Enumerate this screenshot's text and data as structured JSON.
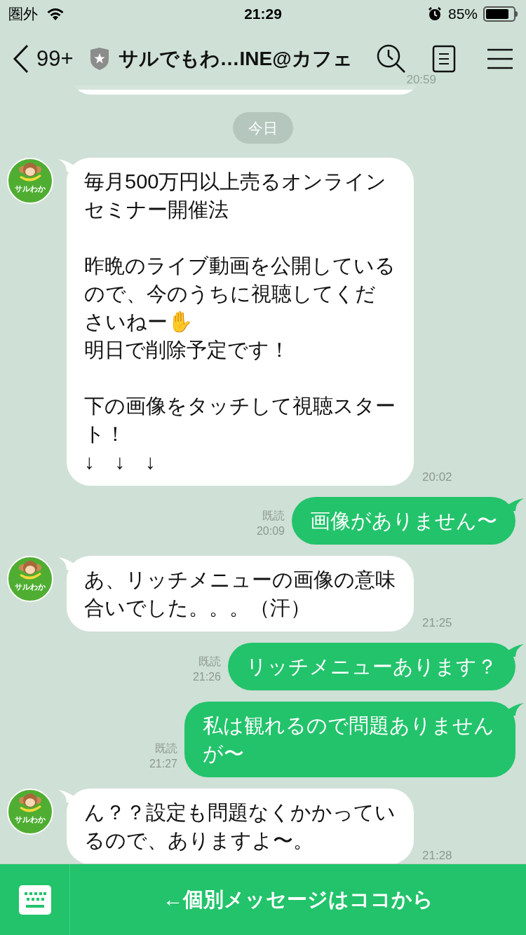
{
  "status_bar": {
    "carrier": "圏外",
    "time": "21:29",
    "battery": "85%"
  },
  "header": {
    "back_count": "99+",
    "title": "サルでもわ…INE@カフェ"
  },
  "preview": {
    "time": "20:59"
  },
  "date_label": "今日",
  "messages": [
    {
      "kind": "incoming",
      "avatar_label": "サルわか",
      "time": "20:02",
      "body": [
        [
          {
            "text": "毎月500万円以上売るオンラインセミナー開催法"
          }
        ],
        [
          {
            "text": "昨晩のライブ動画を公開しているので、今のうちに視聴してくださいねー✋"
          },
          {
            "text": "明日で削除予定です！"
          }
        ],
        [
          {
            "text": "下の画像をタッチして視聴スタート！"
          },
          {
            "text": "↓　↓　↓"
          }
        ]
      ]
    },
    {
      "kind": "outgoing",
      "read": "既読",
      "time": "20:09",
      "body": [
        [
          {
            "text": "画像がありません〜"
          }
        ]
      ]
    },
    {
      "kind": "incoming",
      "avatar_label": "サルわか",
      "time": "21:25",
      "body": [
        [
          {
            "text": "あ、リッチメニューの画像の意味合いでした。。。（汗）"
          }
        ]
      ]
    },
    {
      "kind": "outgoing",
      "read": "既読",
      "time": "21:26",
      "body": [
        [
          {
            "text": "リッチメニューあります？"
          }
        ]
      ]
    },
    {
      "kind": "outgoing",
      "read": "既読",
      "time": "21:27",
      "body": [
        [
          {
            "text": "私は観れるので問題ありませんが〜"
          }
        ]
      ]
    },
    {
      "kind": "incoming",
      "avatar_label": "サルわか",
      "time": "21:28",
      "body": [
        [
          {
            "text": "ん？？設定も問題なくかかっているので、ありますよ〜。"
          }
        ]
      ]
    }
  ],
  "bottom_bar": {
    "label": "←個別メッセージはココから"
  }
}
